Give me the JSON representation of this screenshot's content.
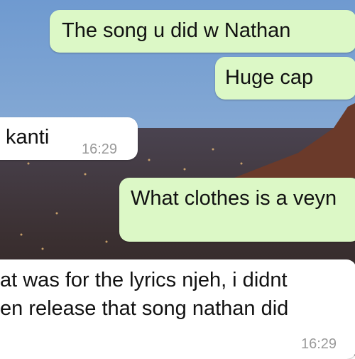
{
  "chat": {
    "messages": [
      {
        "direction": "outgoing",
        "text": "The song u did w Nathan"
      },
      {
        "direction": "outgoing",
        "text": "Huge cap"
      },
      {
        "direction": "incoming",
        "text": "kanti",
        "time": "16:29"
      },
      {
        "direction": "outgoing",
        "text": "What clothes is a veyn"
      },
      {
        "direction": "incoming",
        "lines": [
          "at was for the lyrics njeh, i didnt",
          "en release that song nathan did"
        ],
        "time": "16:29"
      }
    ]
  },
  "colors": {
    "outgoing_bubble": "#dcf8c6",
    "incoming_bubble": "#ffffff",
    "timestamp": "#9a9a9a"
  }
}
